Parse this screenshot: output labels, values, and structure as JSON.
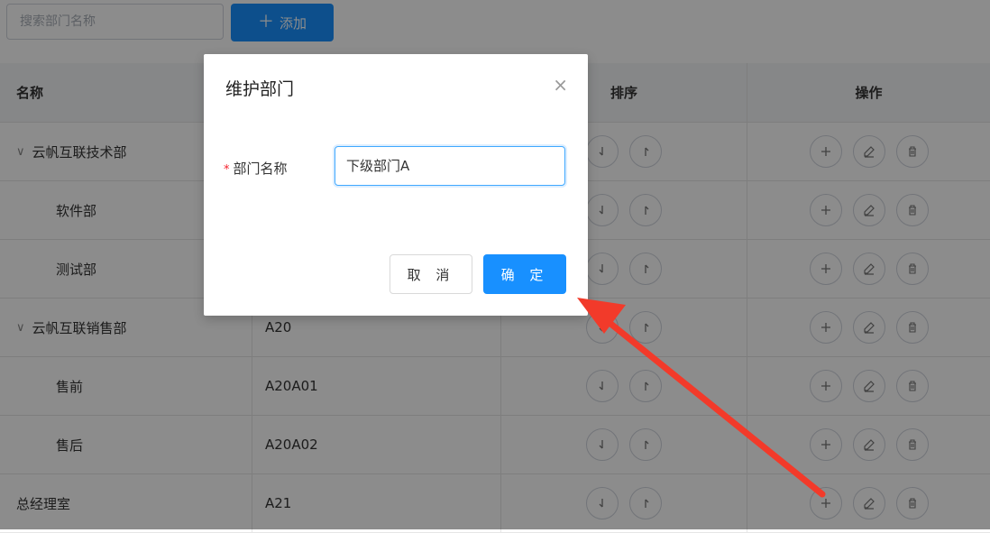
{
  "toolbar": {
    "search_placeholder": "搜索部门名称",
    "add_label": "添加",
    "add_icon": "plus-icon"
  },
  "table": {
    "headers": {
      "name": "名称",
      "code": "",
      "sort": "排序",
      "ops": "操作"
    },
    "rows": [
      {
        "name": "云帆互联技术部",
        "code": "",
        "expanded": true,
        "level": 0
      },
      {
        "name": "软件部",
        "code": "",
        "level": 1
      },
      {
        "name": "测试部",
        "code": "",
        "level": 1
      },
      {
        "name": "云帆互联销售部",
        "code": "A20",
        "expanded": true,
        "level": 0
      },
      {
        "name": "售前",
        "code": "A20A01",
        "level": 1
      },
      {
        "name": "售后",
        "code": "A20A02",
        "level": 1
      },
      {
        "name": "总经理室",
        "code": "A21",
        "level": 0
      }
    ]
  },
  "modal": {
    "title": "维护部门",
    "field_label": "部门名称",
    "field_value": "下级部门A",
    "cancel_label": "取 消",
    "ok_label": "确 定"
  },
  "colors": {
    "primary": "#1890ff",
    "required": "#f5222d",
    "annotation_arrow": "#f23a2a"
  }
}
